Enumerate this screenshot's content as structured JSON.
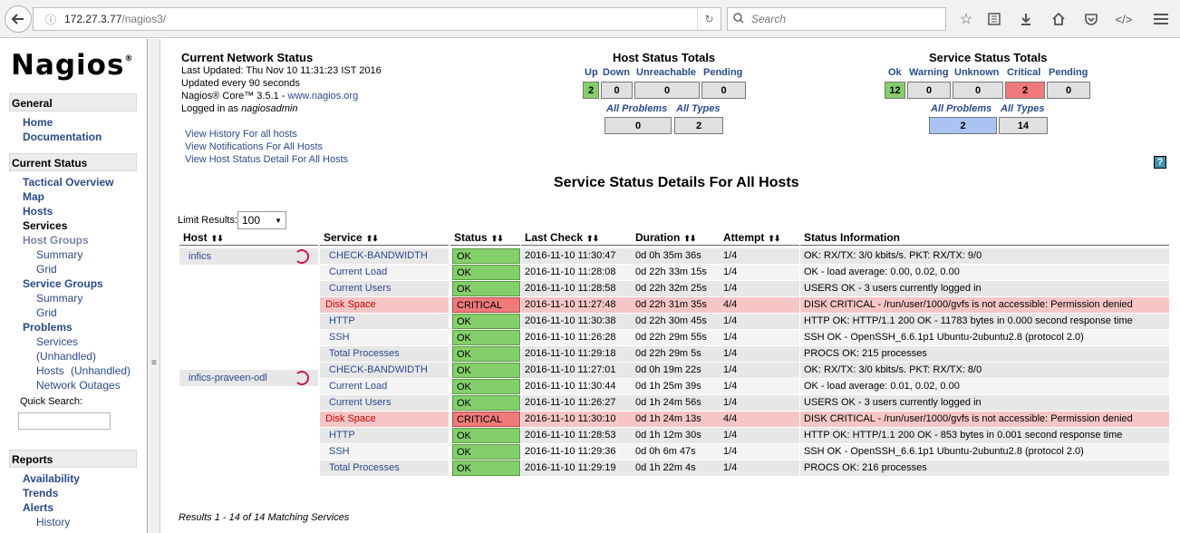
{
  "browser": {
    "url_host": "172.27.3.77",
    "url_path": "/nagios3/",
    "search_placeholder": "Search"
  },
  "sidebar": {
    "logo": "Nagios",
    "logo_mark": "®",
    "general_title": "General",
    "general_items": [
      "Home",
      "Documentation"
    ],
    "current_status_title": "Current Status",
    "tactical_overview": "Tactical Overview",
    "map": "Map",
    "hosts": "Hosts",
    "services": "Services",
    "host_groups": "Host Groups",
    "host_groups_summary": "Summary",
    "host_groups_grid": "Grid",
    "service_groups": "Service Groups",
    "service_groups_summary": "Summary",
    "service_groups_grid": "Grid",
    "problems": "Problems",
    "problems_services": "Services",
    "problems_unhandled_1": "(Unhandled)",
    "problems_hosts": "Hosts",
    "problems_unhandled_2": "(Unhandled)",
    "network_outages": "Network Outages",
    "quick_search_label": "Quick Search:",
    "reports_title": "Reports",
    "availability": "Availability",
    "trends": "Trends",
    "alerts": "Alerts",
    "alerts_history": "History"
  },
  "status": {
    "title": "Current Network Status",
    "last_updated": "Last Updated: Thu Nov 10 11:31:23 IST 2016",
    "updated_every": "Updated every 90 seconds",
    "core_prefix": "Nagios® Core™ 3.5.1 - ",
    "core_link": "www.nagios.org",
    "logged_in_prefix": "Logged in as ",
    "logged_in_user": "nagiosadmin",
    "links": [
      "View History For all hosts",
      "View Notifications For All Hosts",
      "View Host Status Detail For All Hosts"
    ]
  },
  "host_totals": {
    "title": "Host Status Totals",
    "labels": [
      "Up",
      "Down",
      "Unreachable",
      "Pending"
    ],
    "values": [
      "2",
      "0",
      "0",
      "0"
    ],
    "sub_labels": [
      "All Problems",
      "All Types"
    ],
    "sub_values": [
      "0",
      "2"
    ]
  },
  "service_totals": {
    "title": "Service Status Totals",
    "labels": [
      "Ok",
      "Warning",
      "Unknown",
      "Critical",
      "Pending"
    ],
    "values": [
      "12",
      "0",
      "0",
      "2",
      "0"
    ],
    "sub_labels": [
      "All Problems",
      "All Types"
    ],
    "sub_values": [
      "2",
      "14"
    ]
  },
  "page_title": "Service Status Details For All Hosts",
  "limit": {
    "label": "Limit Results:",
    "value": "100"
  },
  "table": {
    "headers": [
      "Host",
      "Service",
      "Status",
      "Last Check",
      "Duration",
      "Attempt",
      "Status Information"
    ],
    "hosts": [
      "infics",
      "infics-praveen-odl"
    ],
    "rows": [
      {
        "service": "CHECK-BANDWIDTH",
        "status": "OK",
        "last_check": "2016-11-10 11:30:47",
        "duration": "0d 0h 35m 36s",
        "attempt": "1/4",
        "info": "OK: RX/TX: 3/0 kbits/s. PKT: RX/TX: 9/0"
      },
      {
        "service": "Current Load",
        "status": "OK",
        "last_check": "2016-11-10 11:28:08",
        "duration": "0d 22h 33m 15s",
        "attempt": "1/4",
        "info": "OK - load average: 0.00, 0.02, 0.00"
      },
      {
        "service": "Current Users",
        "status": "OK",
        "last_check": "2016-11-10 11:28:58",
        "duration": "0d 22h 32m 25s",
        "attempt": "1/4",
        "info": "USERS OK - 3 users currently logged in"
      },
      {
        "service": "Disk Space",
        "status": "CRITICAL",
        "last_check": "2016-11-10 11:27:48",
        "duration": "0d 22h 31m 35s",
        "attempt": "4/4",
        "info": "DISK CRITICAL - /run/user/1000/gvfs is not accessible: Permission denied"
      },
      {
        "service": "HTTP",
        "status": "OK",
        "last_check": "2016-11-10 11:30:38",
        "duration": "0d 22h 30m 45s",
        "attempt": "1/4",
        "info": "HTTP OK: HTTP/1.1 200 OK - 11783 bytes in 0.000 second response time"
      },
      {
        "service": "SSH",
        "status": "OK",
        "last_check": "2016-11-10 11:26:28",
        "duration": "0d 22h 29m 55s",
        "attempt": "1/4",
        "info": "SSH OK - OpenSSH_6.6.1p1 Ubuntu-2ubuntu2.8 (protocol 2.0)"
      },
      {
        "service": "Total Processes",
        "status": "OK",
        "last_check": "2016-11-10 11:29:18",
        "duration": "0d 22h 29m 5s",
        "attempt": "1/4",
        "info": "PROCS OK: 215 processes"
      },
      {
        "service": "CHECK-BANDWIDTH",
        "status": "OK",
        "last_check": "2016-11-10 11:27:01",
        "duration": "0d 0h 19m 22s",
        "attempt": "1/4",
        "info": "OK: RX/TX: 3/0 kbits/s. PKT: RX/TX: 8/0"
      },
      {
        "service": "Current Load",
        "status": "OK",
        "last_check": "2016-11-10 11:30:44",
        "duration": "0d 1h 25m 39s",
        "attempt": "1/4",
        "info": "OK - load average: 0.01, 0.02, 0.00"
      },
      {
        "service": "Current Users",
        "status": "OK",
        "last_check": "2016-11-10 11:26:27",
        "duration": "0d 1h 24m 56s",
        "attempt": "1/4",
        "info": "USERS OK - 3 users currently logged in"
      },
      {
        "service": "Disk Space",
        "status": "CRITICAL",
        "last_check": "2016-11-10 11:30:10",
        "duration": "0d 1h 24m 13s",
        "attempt": "4/4",
        "info": "DISK CRITICAL - /run/user/1000/gvfs is not accessible: Permission denied"
      },
      {
        "service": "HTTP",
        "status": "OK",
        "last_check": "2016-11-10 11:28:53",
        "duration": "0d 1h 12m 30s",
        "attempt": "1/4",
        "info": "HTTP OK: HTTP/1.1 200 OK - 853 bytes in 0.001 second response time"
      },
      {
        "service": "SSH",
        "status": "OK",
        "last_check": "2016-11-10 11:29:36",
        "duration": "0d 0h 6m 47s",
        "attempt": "1/4",
        "info": "SSH OK - OpenSSH_6.6.1p1 Ubuntu-2ubuntu2.8 (protocol 2.0)"
      },
      {
        "service": "Total Processes",
        "status": "OK",
        "last_check": "2016-11-10 11:29:19",
        "duration": "0d 1h 22m 4s",
        "attempt": "1/4",
        "info": "PROCS OK: 216 processes"
      }
    ]
  },
  "results_text": "Results 1 - 14 of 14 Matching Services",
  "colors": {
    "ok": "#84cf6c",
    "critical": "#f0797a",
    "link": "#2a4b8d"
  }
}
